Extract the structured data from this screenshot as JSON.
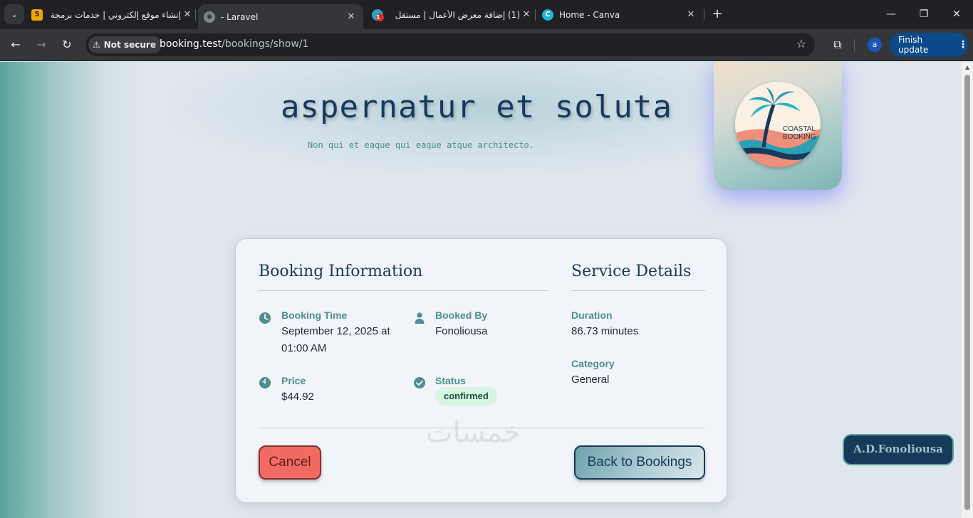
{
  "browser": {
    "tabs": [
      {
        "title": "إنشاء موقع إلكتروني | خدمات برمجة",
        "favicon_text": "5",
        "favicon_color": "#f0a500",
        "active": false
      },
      {
        "title": "- Laravel",
        "active": true
      },
      {
        "title": "(1) إضافة معرض الأعمال | مستقل",
        "favicon_badge": "1",
        "active": false
      },
      {
        "title": "Home - Canva",
        "active": false
      }
    ],
    "security_label": "Not secure",
    "url_host": "booking.test",
    "url_path": "/bookings/show/1",
    "profile_initial": "a",
    "update_label": "Finish update"
  },
  "hero": {
    "title": "aspernatur et soluta",
    "subtitle": "Non qui et eaque qui eaque atque architecto."
  },
  "logo": {
    "line1": "COASTAL",
    "line2": "BOOKING"
  },
  "booking": {
    "section_title": "Booking Information",
    "fields": {
      "time_label": "Booking Time",
      "time_value": "September 12, 2025 at 01:00 AM",
      "booked_by_label": "Booked By",
      "booked_by_value": "Fonoliousa",
      "price_label": "Price",
      "price_value": "$44.92",
      "status_label": "Status",
      "status_value": "confirmed"
    }
  },
  "service": {
    "section_title": "Service Details",
    "duration_label": "Duration",
    "duration_value": "86.73 minutes",
    "category_label": "Category",
    "category_value": "General"
  },
  "actions": {
    "cancel_label": "Cancel",
    "back_label": "Back to Bookings"
  },
  "watermark": "خمسات",
  "footer_badge": "A.D.Fonoliousa",
  "colors": {
    "navy": "#17395a",
    "teal": "#4c8f8f",
    "cancel_red": "#f26b63",
    "status_green_bg": "#d7f5e3"
  }
}
